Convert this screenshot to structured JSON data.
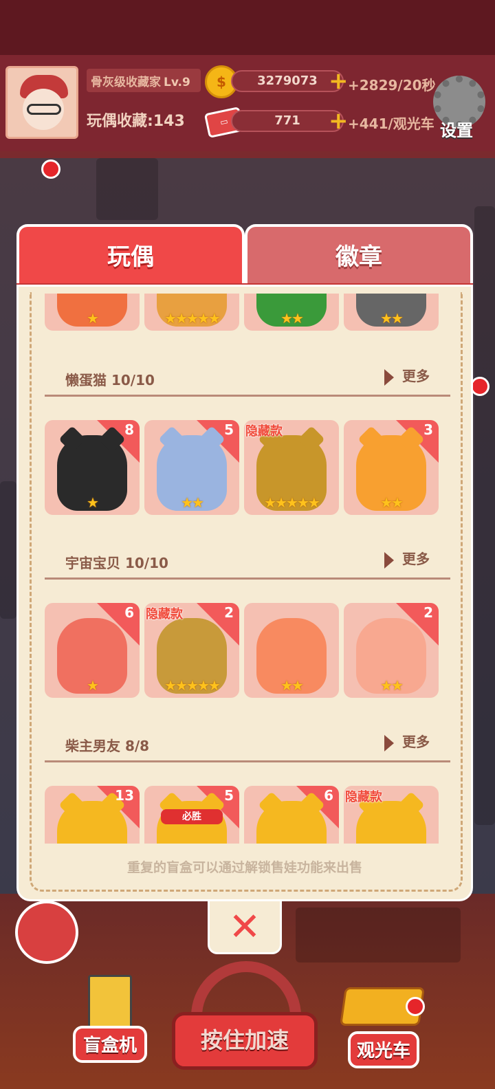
{
  "player": {
    "title": "骨灰级收藏家",
    "level": "Lv.9",
    "collection_label": "玩偶收藏",
    "collection_count": "143"
  },
  "resources": {
    "coin_icon_text": "$",
    "coins": "3279073",
    "coin_rate": "+2829/20秒",
    "tickets": "771",
    "ticket_rate": "+441/观光车",
    "plus": "+"
  },
  "settings_label": "设置",
  "tabs": [
    {
      "label": "玩偶",
      "active": true
    },
    {
      "label": "徽章",
      "active": false
    }
  ],
  "groups": [
    {
      "title": "",
      "more": "",
      "items": [
        {
          "count": "",
          "hidden": "",
          "stars": "★",
          "color": "#f07040"
        },
        {
          "count": "",
          "hidden": "",
          "stars": "★★★★★",
          "color": "#e8a040"
        },
        {
          "count": "",
          "hidden": "",
          "stars": "★★",
          "color": "#3a9a3a"
        },
        {
          "count": "",
          "hidden": "",
          "stars": "★★",
          "color": "#666666"
        }
      ]
    },
    {
      "title": "懒蛋猫 10/10",
      "more": "更多",
      "items": [
        {
          "count": "8",
          "hidden": "",
          "stars": "★",
          "color": "#2a2a2a"
        },
        {
          "count": "5",
          "hidden": "",
          "stars": "★★",
          "color": "#9ab4e0"
        },
        {
          "count": "",
          "hidden": "隐藏款",
          "stars": "★★★★★",
          "color": "#c8962a"
        },
        {
          "count": "3",
          "hidden": "",
          "stars": "★★",
          "color": "#f8a030"
        }
      ]
    },
    {
      "title": "宇宙宝贝 10/10",
      "more": "更多",
      "items": [
        {
          "count": "6",
          "hidden": "",
          "stars": "★",
          "color": "#f07060"
        },
        {
          "count": "2",
          "hidden": "隐藏款",
          "stars": "★★★★★",
          "color": "#c89a3a"
        },
        {
          "count": "",
          "hidden": "",
          "stars": "★★",
          "color": "#f88a60"
        },
        {
          "count": "2",
          "hidden": "",
          "stars": "★★",
          "color": "#f8a890"
        }
      ]
    },
    {
      "title": "柴主男友 8/8",
      "more": "更多",
      "items": [
        {
          "count": "13",
          "hidden": "",
          "stars": "",
          "color": "#f5b820"
        },
        {
          "count": "5",
          "hidden": "",
          "stars": "",
          "color": "#f5b820",
          "headband": "必胜"
        },
        {
          "count": "6",
          "hidden": "",
          "stars": "",
          "color": "#f5b820"
        },
        {
          "count": "",
          "hidden": "隐藏款",
          "stars": "",
          "color": "#f5b820"
        }
      ]
    }
  ],
  "footer_note": "重复的盲盒可以通过解锁售娃功能来出售",
  "close_label": "✕",
  "bottom": {
    "blind_box": "盲盒机",
    "speed_up": "按住加速",
    "tour_bus": "观光车"
  },
  "colors": {
    "accent_red": "#f04848",
    "panel_bg": "#f6ebd4",
    "card_bg": "#f5c0b2",
    "star": "#ffc21c"
  }
}
